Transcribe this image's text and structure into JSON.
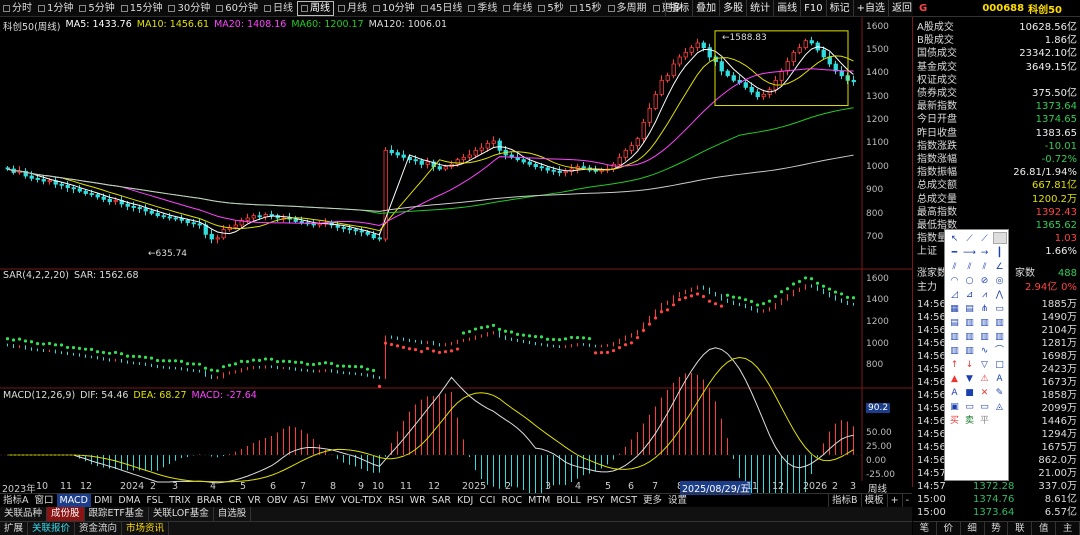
{
  "toolbar": {
    "periods": [
      "分时",
      "1分钟",
      "5分钟",
      "15分钟",
      "30分钟",
      "60分钟",
      "日线",
      "周线",
      "月线",
      "10分钟",
      "45日线",
      "季线",
      "年线",
      "5秒",
      "15秒",
      "多周期",
      "更多"
    ],
    "selected": "周线",
    "right": [
      "指标",
      "叠加",
      "多股",
      "统计",
      "画线",
      "F10",
      "标记",
      "+自选",
      "返回"
    ]
  },
  "main_panel": {
    "legend": [
      {
        "label": "科创50(周线)",
        "color": "#dddddd"
      },
      {
        "label": "MA5: 1433.76",
        "color": "#ffffff"
      },
      {
        "label": "MA10: 1456.61",
        "color": "#e0e000"
      },
      {
        "label": "MA20: 1408.16",
        "color": "#ff44ff"
      },
      {
        "label": "MA60: 1200.17",
        "color": "#22cc22"
      },
      {
        "label": "MA120: 1006.01",
        "color": "#dddddd"
      }
    ],
    "y_ticks": [
      "1600",
      "1500",
      "1400",
      "1300",
      "1200",
      "1100",
      "1000",
      "900",
      "800",
      "700"
    ],
    "high_label": "1588.83",
    "low_label": "635.74"
  },
  "sar_panel": {
    "legend": [
      {
        "label": "SAR(4,2,2,20)",
        "color": "#dddddd"
      },
      {
        "label": "SAR: 1562.68",
        "color": "#dddddd"
      }
    ],
    "y_ticks": [
      "1600",
      "1400",
      "1200",
      "1000",
      "800"
    ]
  },
  "macd_panel": {
    "legend": [
      {
        "label": "MACD(12,26,9)",
        "color": "#dddddd"
      },
      {
        "label": "DIF: 54.46",
        "color": "#dddddd"
      },
      {
        "label": "DEA: 68.27",
        "color": "#e0e000"
      },
      {
        "label": "MACD: -27.64",
        "color": "#ff44ff"
      }
    ],
    "y_ticks": [
      "90.2",
      "50.00",
      "25.00",
      "0.00",
      "-25.00"
    ]
  },
  "x_axis": {
    "labels": [
      "2023年",
      "10",
      "11",
      "12",
      "2024",
      "2",
      "3",
      "4",
      "5",
      "6",
      "7",
      "8",
      "9",
      "10",
      "11",
      "12",
      "2025",
      "2",
      "3",
      "4",
      "5",
      "6",
      "7",
      "8",
      "2025/08/29/五",
      "11",
      "12",
      "2026",
      "2",
      "3"
    ],
    "right_label": "周线"
  },
  "indicator_tabs": {
    "items": [
      "指标A",
      "窗口",
      "MACD",
      "DMI",
      "DMA",
      "FSL",
      "TRIX",
      "BRAR",
      "CR",
      "VR",
      "OBV",
      "ASI",
      "EMV",
      "VOL-TDX",
      "RSI",
      "WR",
      "SAR",
      "KDJ",
      "CCI",
      "ROC",
      "MTM",
      "BOLL",
      "PSY",
      "MCST",
      "更多",
      "设置"
    ],
    "selected": "MACD",
    "right": [
      "指标B",
      "模板",
      "+",
      "-"
    ]
  },
  "bottom_tabs": {
    "items": [
      "关联品种",
      "成份股",
      "跟踪ETF基金",
      "关联LOF基金",
      "自选股"
    ],
    "selected": "成份股"
  },
  "status": [
    "扩展",
    "关联报价",
    "资金流向",
    "市场资讯"
  ],
  "right_panel": {
    "header_letter": "G",
    "code": "000688",
    "name": "科创50",
    "rows": [
      {
        "label": "A股成交",
        "value": "10628.56亿",
        "color": "#eeeeee"
      },
      {
        "label": "B股成交",
        "value": "1.86亿",
        "color": "#eeeeee"
      },
      {
        "label": "国债成交",
        "value": "23342.10亿",
        "color": "#eeeeee"
      },
      {
        "label": "基金成交",
        "value": "3649.15亿",
        "color": "#eeeeee"
      },
      {
        "label": "权证成交",
        "value": "",
        "color": "#eeeeee"
      },
      {
        "label": "债券成交",
        "value": "375.50亿",
        "color": "#eeeeee"
      },
      {
        "label": "最新指数",
        "value": "1373.64",
        "color": "#33cc55"
      },
      {
        "label": "今日开盘",
        "value": "1374.65",
        "color": "#33cc55"
      },
      {
        "label": "昨日收盘",
        "value": "1383.65",
        "color": "#eeeeee"
      },
      {
        "label": "指数涨跌",
        "value": "-10.01",
        "color": "#33cc55"
      },
      {
        "label": "指数涨幅",
        "value": "-0.72%",
        "color": "#33cc55"
      },
      {
        "label": "指数振幅",
        "value": "26.81/1.94%",
        "color": "#eeeeee"
      },
      {
        "label": "总成交额",
        "value": "667.81亿",
        "color": "#e0e000"
      },
      {
        "label": "总成交量",
        "value": "1200.2万",
        "color": "#e0e000"
      },
      {
        "label": "最高指数",
        "value": "1392.43",
        "color": "#ff4444"
      },
      {
        "label": "最低指数",
        "value": "1365.62",
        "color": "#33cc55"
      },
      {
        "label": "指数量比",
        "value": "1.03",
        "color": "#ff4444"
      },
      {
        "label": "上证",
        "value": "1.66%",
        "color": "#eeeeee"
      }
    ],
    "breadth": {
      "left": "涨家数",
      "right": "家数",
      "value": "488"
    },
    "main_flow": {
      "label": "主力",
      "value": "2.94亿",
      "pct": "0%"
    },
    "ticks": [
      {
        "time": "14:56",
        "price": "",
        "vol": "1885万"
      },
      {
        "time": "14:56",
        "price": "",
        "vol": "1490万"
      },
      {
        "time": "14:56",
        "price": "",
        "vol": "2104万"
      },
      {
        "time": "14:56",
        "price": "",
        "vol": "1281万"
      },
      {
        "time": "14:56",
        "price": "",
        "vol": "1698万"
      },
      {
        "time": "14:56",
        "price": "",
        "vol": "2423万"
      },
      {
        "time": "14:56",
        "price": "",
        "vol": "1673万"
      },
      {
        "time": "14:56",
        "price": "",
        "vol": "1858万"
      },
      {
        "time": "14:56",
        "price": "",
        "vol": "2099万"
      },
      {
        "time": "14:56",
        "price": "",
        "vol": "1446万"
      },
      {
        "time": "14:56",
        "price": "",
        "vol": "1294万"
      },
      {
        "time": "14:56",
        "price": "",
        "vol": "1675万"
      },
      {
        "time": "14:56",
        "price": "",
        "vol": "862.0万"
      },
      {
        "time": "14:57",
        "price": "",
        "vol": "21.00万"
      },
      {
        "time": "14:57",
        "price": "1372.28",
        "vol": "337.0万"
      },
      {
        "time": "15:00",
        "price": "1374.76",
        "vol": "8.61亿"
      },
      {
        "time": "15:00",
        "price": "1373.64",
        "vol": "6.57亿"
      }
    ],
    "tabs": [
      "笔",
      "价",
      "细",
      "势",
      "联",
      "值",
      "主"
    ]
  },
  "draw_tool": {
    "icons": [
      "cursor-icon",
      "line-segment-icon",
      "line-icon",
      "ray-icon",
      "hline-icon",
      "hsegment-icon",
      "hray-icon",
      "vline-icon",
      "parallel-icon",
      "channel-icon",
      "fib-channel-icon",
      "angle-icon",
      "arc-icon",
      "circle-icon",
      "ellipse-icon",
      "cycle-icon",
      "fib-fan-icon",
      "gann-fan-icon",
      "speed-resist-icon",
      "triangle-line-icon",
      "gann-box-icon",
      "fib-box-icon",
      "pitchfork-icon",
      "rectangle-icon",
      "text-box-icon",
      "period-icon",
      "bars-icon",
      "fib-lines-icon",
      "price-range-icon",
      "regression-icon",
      "gann-lines-icon",
      "levels-icon",
      "vertical-bars-icon",
      "dense-bars-icon",
      "wave-icon",
      "curve-icon",
      "up-arrow-icon",
      "down-arrow-icon",
      "triangle-icon",
      "square-icon",
      "up-mark-icon",
      "down-mark-icon",
      "warning-icon",
      "text-icon",
      "text-a-icon",
      "gray-box-icon",
      "delete-icon",
      "pencil-icon",
      "note-icon",
      "box-text-icon",
      "rect-text-icon",
      "compass-icon",
      "buy-icon",
      "sell-icon",
      "flag-icon",
      "hide-icon",
      "lock-icon",
      "settings-icon"
    ],
    "labels": {
      "buy": "买",
      "sell": "卖",
      "flag": "平"
    }
  }
}
